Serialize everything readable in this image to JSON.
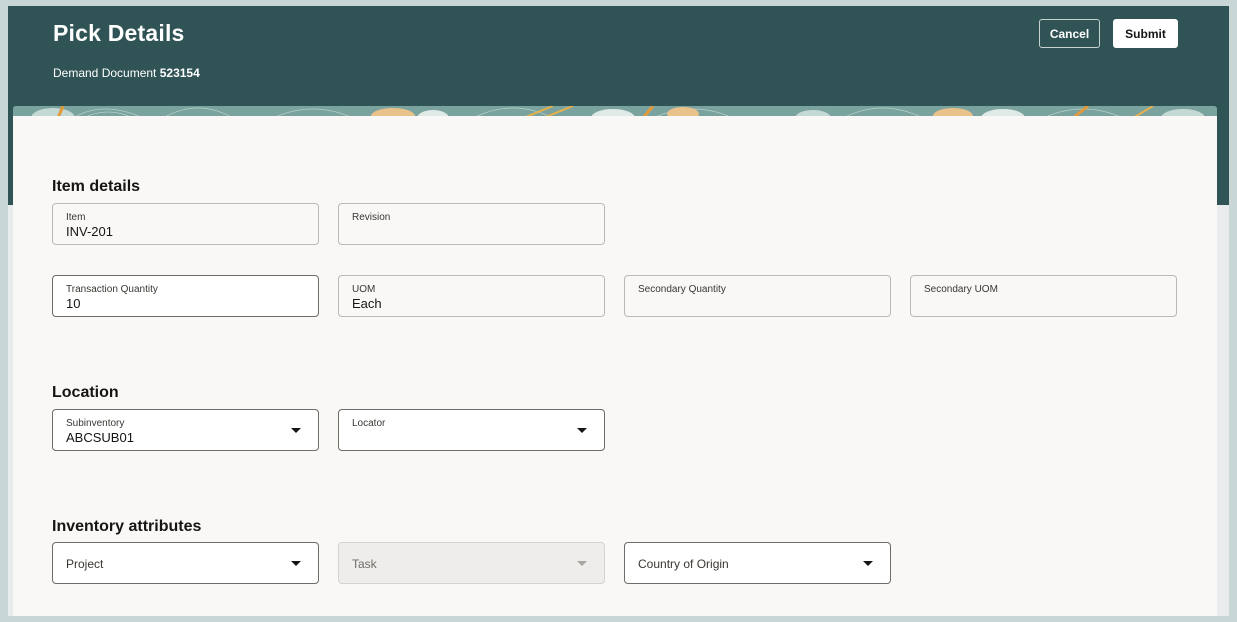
{
  "header": {
    "title": "Pick Details",
    "subtitle_label": "Demand Document",
    "subtitle_value": "523154",
    "cancel_label": "Cancel",
    "submit_label": "Submit"
  },
  "item_details": {
    "title": "Item details",
    "item": {
      "label": "Item",
      "value": "INV-201"
    },
    "revision": {
      "label": "Revision",
      "value": ""
    },
    "transaction_quantity": {
      "label": "Transaction Quantity",
      "value": "10"
    },
    "uom": {
      "label": "UOM",
      "value": "Each"
    },
    "secondary_quantity": {
      "label": "Secondary Quantity",
      "value": ""
    },
    "secondary_uom": {
      "label": "Secondary UOM",
      "value": ""
    }
  },
  "location": {
    "title": "Location",
    "subinventory": {
      "label": "Subinventory",
      "value": "ABCSUB01"
    },
    "locator": {
      "label": "Locator",
      "value": ""
    }
  },
  "inventory_attributes": {
    "title": "Inventory attributes",
    "project": {
      "label": "Project"
    },
    "task": {
      "label": "Task"
    },
    "country_of_origin": {
      "label": "Country of Origin"
    }
  },
  "colors": {
    "header_bg": "#305356",
    "content_bg": "#f9f8f6",
    "text": "#161513"
  },
  "icons": {
    "dropdown": "chevron-down-icon"
  }
}
